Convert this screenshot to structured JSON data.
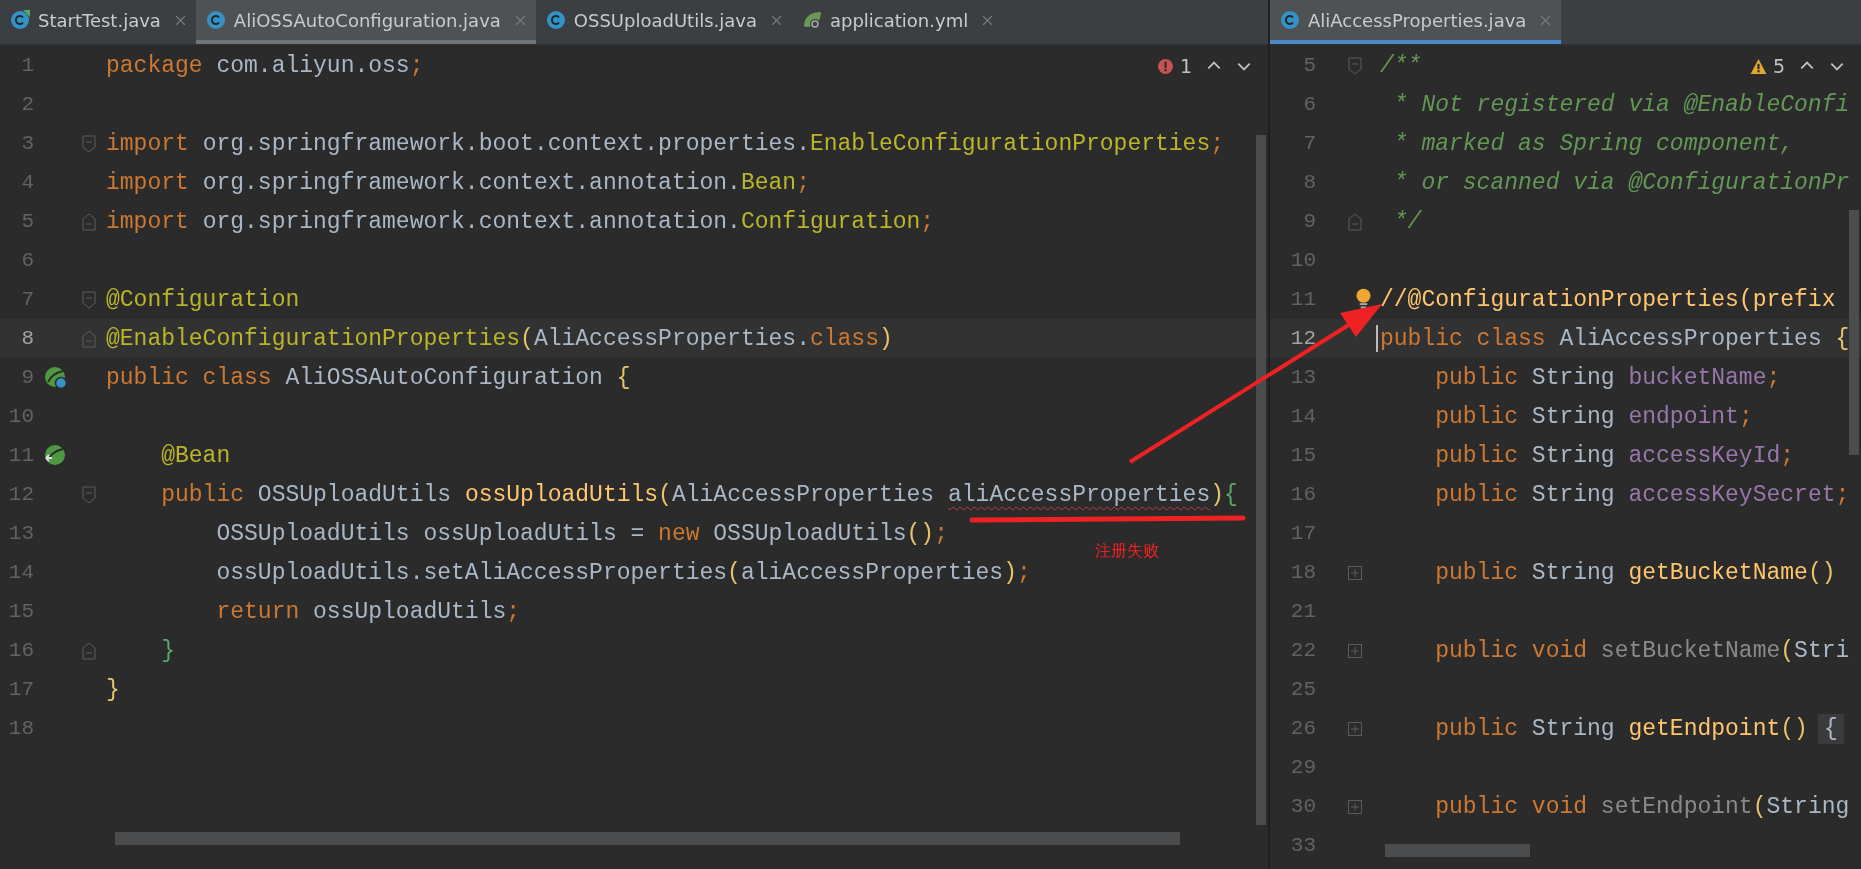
{
  "panes": [
    {
      "focused": false,
      "tabs": [
        {
          "label": "StartTest.java",
          "kind": "class-run",
          "selected": false
        },
        {
          "label": "AliOSSAutoConfiguration.java",
          "kind": "class",
          "selected": true
        },
        {
          "label": "OSSUploadUtils.java",
          "kind": "class",
          "selected": false
        },
        {
          "label": "application.yml",
          "kind": "yml",
          "selected": false
        }
      ],
      "inspection": {
        "kind": "error",
        "count": "1"
      },
      "lines": [
        {
          "number": "1",
          "current": false,
          "tokens": [
            {
              "kind": "kw",
              "text": "package"
            },
            {
              "kind": "id",
              "text": " com.aliyun.oss"
            },
            {
              "kind": "punct",
              "text": ";"
            }
          ]
        },
        {
          "number": "2",
          "current": false
        },
        {
          "number": "3",
          "current": false,
          "markers": [
            {
              "kind": "fold-start"
            }
          ],
          "tokens": [
            {
              "kind": "kw",
              "text": "import"
            },
            {
              "kind": "id",
              "text": " org.springframework.boot.context.properties."
            },
            {
              "kind": "ann",
              "text": "EnableConfigurationProperties"
            },
            {
              "kind": "punct",
              "text": ";"
            }
          ]
        },
        {
          "number": "4",
          "current": false,
          "tokens": [
            {
              "kind": "kw",
              "text": "import"
            },
            {
              "kind": "id",
              "text": " org.springframework.context.annotation."
            },
            {
              "kind": "ann",
              "text": "Bean"
            },
            {
              "kind": "punct",
              "text": ";"
            }
          ]
        },
        {
          "number": "5",
          "current": false,
          "markers": [
            {
              "kind": "fold-end"
            }
          ],
          "tokens": [
            {
              "kind": "kw",
              "text": "import"
            },
            {
              "kind": "id",
              "text": " org.springframework.context.annotation."
            },
            {
              "kind": "ann",
              "text": "Configuration"
            },
            {
              "kind": "punct",
              "text": ";"
            }
          ]
        },
        {
          "number": "6",
          "current": false
        },
        {
          "number": "7",
          "current": false,
          "markers": [
            {
              "kind": "fold-start"
            }
          ],
          "tokens": [
            {
              "kind": "ann",
              "text": "@Configuration"
            }
          ]
        },
        {
          "number": "8",
          "current": true,
          "markers": [
            {
              "kind": "fold-end"
            }
          ],
          "tokens": [
            {
              "kind": "ann",
              "text": "@EnableConfigurationProperties"
            },
            {
              "kind": "paren",
              "text": "("
            },
            {
              "kind": "id",
              "text": "AliAccessProperties."
            },
            {
              "kind": "kw",
              "text": "class"
            },
            {
              "kind": "paren",
              "text": ")"
            }
          ]
        },
        {
          "number": "9",
          "current": false,
          "markers": [
            {
              "kind": "bean-config"
            }
          ],
          "tokens": [
            {
              "kind": "kw",
              "text": "public class"
            },
            {
              "kind": "id",
              "text": " AliOSSAutoConfiguration "
            },
            {
              "kind": "paren",
              "text": "{"
            }
          ]
        },
        {
          "number": "10",
          "current": false
        },
        {
          "number": "11",
          "current": false,
          "markers": [
            {
              "kind": "bean"
            }
          ],
          "tokens": [
            {
              "kind": "ann",
              "text": "    @Bean"
            }
          ]
        },
        {
          "number": "12",
          "current": false,
          "markers": [
            {
              "kind": "fold-start"
            }
          ],
          "tokens": [
            {
              "kind": "kw",
              "text": "    public"
            },
            {
              "kind": "id",
              "text": " OSSUploadUtils "
            },
            {
              "kind": "fn",
              "text": "ossUploadUtils"
            },
            {
              "kind": "paren",
              "text": "("
            },
            {
              "kind": "id",
              "text": "AliAccessProperties "
            },
            {
              "kind": "id",
              "text": "aliAccessProperties",
              "squiggle": true
            },
            {
              "kind": "paren",
              "text": ")"
            },
            {
              "kind": "match",
              "text": "{"
            }
          ]
        },
        {
          "number": "13",
          "current": false,
          "tokens": [
            {
              "kind": "id",
              "text": "        OSSUploadUtils ossUploadUtils = "
            },
            {
              "kind": "kw",
              "text": "new"
            },
            {
              "kind": "id",
              "text": " OSSUploadUtils"
            },
            {
              "kind": "paren",
              "text": "()"
            },
            {
              "kind": "punct",
              "text": ";"
            }
          ]
        },
        {
          "number": "14",
          "current": false,
          "tokens": [
            {
              "kind": "id",
              "text": "        ossUploadUtils.setAliAccessProperties"
            },
            {
              "kind": "paren",
              "text": "("
            },
            {
              "kind": "id",
              "text": "aliAccessProperties"
            },
            {
              "kind": "paren",
              "text": ")"
            },
            {
              "kind": "punct",
              "text": ";"
            }
          ]
        },
        {
          "number": "15",
          "current": false,
          "tokens": [
            {
              "kind": "kw",
              "text": "        return"
            },
            {
              "kind": "id",
              "text": " ossUploadUtils"
            },
            {
              "kind": "punct",
              "text": ";"
            }
          ]
        },
        {
          "number": "16",
          "current": false,
          "markers": [
            {
              "kind": "fold-end"
            }
          ],
          "tokens": [
            {
              "kind": "match",
              "text": "    }"
            }
          ]
        },
        {
          "number": "17",
          "current": false,
          "tokens": [
            {
              "kind": "paren",
              "text": "}"
            }
          ]
        },
        {
          "number": "18",
          "current": false
        }
      ]
    },
    {
      "focused": true,
      "tabs": [
        {
          "label": "AliAccessProperties.java",
          "kind": "class",
          "selected": true
        }
      ],
      "inspection": {
        "kind": "warning",
        "count": "5"
      },
      "lines": [
        {
          "number": "5",
          "current": false,
          "markers": [
            {
              "kind": "fold-start"
            }
          ],
          "tokens": [
            {
              "kind": "doc",
              "text": "/**"
            }
          ]
        },
        {
          "number": "6",
          "current": false,
          "tokens": [
            {
              "kind": "doc",
              "text": " * Not registered via @EnableConfi"
            }
          ]
        },
        {
          "number": "7",
          "current": false,
          "tokens": [
            {
              "kind": "doc",
              "text": " * marked as Spring component,"
            }
          ]
        },
        {
          "number": "8",
          "current": false,
          "tokens": [
            {
              "kind": "doc",
              "text": " * or scanned via @ConfigurationPr"
            }
          ]
        },
        {
          "number": "9",
          "current": false,
          "markers": [
            {
              "kind": "fold-end"
            }
          ],
          "tokens": [
            {
              "kind": "doc",
              "text": " */"
            }
          ]
        },
        {
          "number": "10",
          "current": false
        },
        {
          "number": "11",
          "current": false,
          "bulb": true,
          "tokens": [
            {
              "kind": "fn",
              "text": "//@ConfigurationProperties(prefix"
            }
          ]
        },
        {
          "number": "12",
          "current": true,
          "tokens": [
            {
              "kind": "kw",
              "text": "public class"
            },
            {
              "kind": "id",
              "text": " AliAccessProperties "
            },
            {
              "kind": "paren",
              "text": "{"
            }
          ]
        },
        {
          "number": "13",
          "current": false,
          "tokens": [
            {
              "kind": "kw",
              "text": "    public"
            },
            {
              "kind": "id",
              "text": " String "
            },
            {
              "kind": "field",
              "text": "bucketName"
            },
            {
              "kind": "punct",
              "text": ";"
            }
          ]
        },
        {
          "number": "14",
          "current": false,
          "tokens": [
            {
              "kind": "kw",
              "text": "    public"
            },
            {
              "kind": "id",
              "text": " String "
            },
            {
              "kind": "field",
              "text": "endpoint"
            },
            {
              "kind": "punct",
              "text": ";"
            }
          ]
        },
        {
          "number": "15",
          "current": false,
          "tokens": [
            {
              "kind": "kw",
              "text": "    public"
            },
            {
              "kind": "id",
              "text": " String "
            },
            {
              "kind": "field",
              "text": "accessKeyId"
            },
            {
              "kind": "punct",
              "text": ";"
            }
          ]
        },
        {
          "number": "16",
          "current": false,
          "tokens": [
            {
              "kind": "kw",
              "text": "    public"
            },
            {
              "kind": "id",
              "text": " String "
            },
            {
              "kind": "field",
              "text": "accessKeySecret"
            },
            {
              "kind": "punct",
              "text": ";"
            }
          ]
        },
        {
          "number": "17",
          "current": false
        },
        {
          "number": "18",
          "current": false,
          "markers": [
            {
              "kind": "fold-collapsed"
            }
          ],
          "tokens": [
            {
              "kind": "kw",
              "text": "    public"
            },
            {
              "kind": "id",
              "text": " String "
            },
            {
              "kind": "fn",
              "text": "getBucketName"
            },
            {
              "kind": "paren",
              "text": "()"
            }
          ]
        },
        {
          "number": "21",
          "current": false
        },
        {
          "number": "22",
          "current": false,
          "markers": [
            {
              "kind": "fold-collapsed"
            }
          ],
          "tokens": [
            {
              "kind": "kw",
              "text": "    public void"
            },
            {
              "kind": "unused",
              "text": " setBucketName"
            },
            {
              "kind": "paren",
              "text": "("
            },
            {
              "kind": "id",
              "text": "Stri"
            }
          ]
        },
        {
          "number": "25",
          "current": false
        },
        {
          "number": "26",
          "current": false,
          "markers": [
            {
              "kind": "fold-collapsed"
            }
          ],
          "tokens": [
            {
              "kind": "kw",
              "text": "    public"
            },
            {
              "kind": "id",
              "text": " String "
            },
            {
              "kind": "fn",
              "text": "getEndpoint"
            },
            {
              "kind": "paren",
              "text": "()"
            },
            {
              "kind": "folded",
              "text": "{"
            }
          ]
        },
        {
          "number": "29",
          "current": false
        },
        {
          "number": "30",
          "current": false,
          "markers": [
            {
              "kind": "fold-collapsed"
            }
          ],
          "tokens": [
            {
              "kind": "kw",
              "text": "    public void"
            },
            {
              "kind": "unused",
              "text": " setEndpoint"
            },
            {
              "kind": "paren",
              "text": "("
            },
            {
              "kind": "id",
              "text": "String"
            }
          ]
        },
        {
          "number": "33",
          "current": false
        }
      ]
    }
  ],
  "annotation": {
    "text": "注册失败"
  }
}
